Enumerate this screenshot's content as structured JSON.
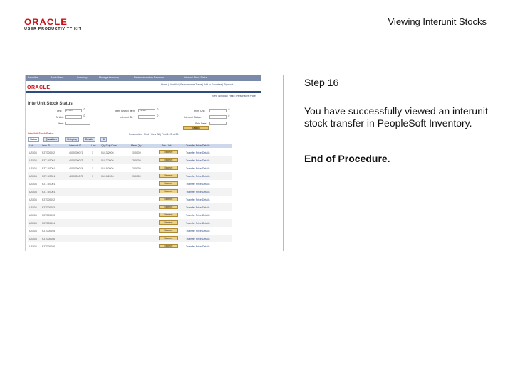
{
  "header": {
    "logo_word": "ORACLE",
    "logo_sub": "USER PRODUCTIVITY KIT",
    "page_title": "Viewing Interunit Stocks"
  },
  "app_screenshot": {
    "top_links": [
      "Favorites",
      "Main Menu",
      "Inventory",
      "Manage Inventory",
      "Review Inventory Balances",
      "Interunit Stock Status"
    ],
    "logo": "ORACLE",
    "top_nav": "Home | Worklist | Performance Trace | Add to Favorites | Sign out",
    "new_window": "New Window | Help | Personalize Page",
    "title": "InterUnit Stock Status",
    "fields": {
      "unit_label": "Unit:",
      "unit_value": "PZ001",
      "to_unit_label": "To Unit:",
      "item_label": "Item:",
      "item_search_label": "Item Search Item:",
      "item_search_value": "PZ001",
      "interunit_id_label": "Interunit ID:",
      "interunit_status_label": "Interunit Status:",
      "from_unit_label": "From Unit:",
      "ship_date_label": "Ship Date:"
    },
    "search_button": "Search",
    "grid_title": "InterUnit Stock Status",
    "grid_nav": "Personalize | Find | View All | First 1-25 of 25",
    "tabs": [
      "Status",
      "Quantities",
      "Shipping",
      "Details"
    ],
    "columns": [
      "Unit",
      "Item ID",
      "Interunit ID",
      "Line",
      "Qty Ship Date",
      "Base Qty",
      "Rec Unit",
      "Transfer Price Details"
    ],
    "rows": [
      {
        "unit": "US004",
        "item": "PZ7000002",
        "id": "4000000071",
        "line": "1",
        "date": "01/13/2006",
        "qty": "10.0000",
        "button": "Receive",
        "link": "Transfer Price Details"
      },
      {
        "unit": "US004",
        "item": "PZ7-US001",
        "id": "4000000073",
        "line": "1",
        "date": "01/17/2006",
        "qty": "25.0000",
        "button": "Receive",
        "link": "Transfer Price Details"
      },
      {
        "unit": "US004",
        "item": "PZ7-US001",
        "id": "4000000074",
        "line": "1",
        "date": "01/19/2006",
        "qty": "20.0000",
        "button": "Receive",
        "link": "Transfer Price Details"
      },
      {
        "unit": "US004",
        "item": "PZ7-US001",
        "id": "4000000075",
        "line": "1",
        "date": "01/19/2006",
        "qty": "15.0000",
        "button": "Receive",
        "link": "Transfer Price Details"
      },
      {
        "unit": "US004",
        "item": "PZ7-US001",
        "id": "",
        "line": "",
        "date": "",
        "qty": "",
        "button": "Receive",
        "link": "Transfer Price Details"
      },
      {
        "unit": "US004",
        "item": "PZ7-US001",
        "id": "",
        "line": "",
        "date": "",
        "qty": "",
        "button": "Receive",
        "link": "Transfer Price Details"
      },
      {
        "unit": "US004",
        "item": "PZ7000002",
        "id": "",
        "line": "",
        "date": "",
        "qty": "",
        "button": "Receive",
        "link": "Transfer Price Details"
      },
      {
        "unit": "US004",
        "item": "PZ7000003",
        "id": "",
        "line": "",
        "date": "",
        "qty": "",
        "button": "Receive",
        "link": "Transfer Price Details"
      },
      {
        "unit": "US004",
        "item": "PZ7000003",
        "id": "",
        "line": "",
        "date": "",
        "qty": "",
        "button": "Receive",
        "link": "Transfer Price Details"
      },
      {
        "unit": "US004",
        "item": "PZ7000004",
        "id": "",
        "line": "",
        "date": "",
        "qty": "",
        "button": "Receive",
        "link": "Transfer Price Details"
      },
      {
        "unit": "US004",
        "item": "PZ7000005",
        "id": "",
        "line": "",
        "date": "",
        "qty": "",
        "button": "Receive",
        "link": "Transfer Price Details"
      },
      {
        "unit": "US004",
        "item": "PZ7000006",
        "id": "",
        "line": "",
        "date": "",
        "qty": "",
        "button": "Receive",
        "link": "Transfer Price Details"
      },
      {
        "unit": "US004",
        "item": "PZ7000006",
        "id": "",
        "line": "",
        "date": "",
        "qty": "",
        "button": "Receive",
        "link": "Transfer Price Details"
      }
    ]
  },
  "panel": {
    "step": "Step 16",
    "description": "You have successfully viewed an interunit stock transfer in PeopleSoft Inventory.",
    "end": "End of Procedure."
  }
}
